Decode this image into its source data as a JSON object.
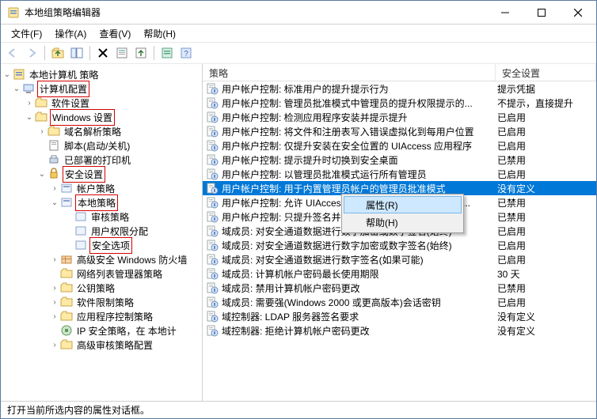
{
  "window": {
    "title": "本地组策略编辑器"
  },
  "menubar": [
    {
      "id": "file",
      "label": "文件(F)"
    },
    {
      "id": "action",
      "label": "操作(A)"
    },
    {
      "id": "view",
      "label": "查看(V)"
    },
    {
      "id": "help",
      "label": "帮助(H)"
    }
  ],
  "tree": {
    "root": "本地计算机 策略",
    "computer_config": "计算机配置",
    "software_settings": "软件设置",
    "windows_settings": "Windows 设置",
    "dns_policy": "域名解析策略",
    "scripts": "脚本(启动/关机)",
    "deployed_printers": "已部署的打印机",
    "security_settings": "安全设置",
    "account_policies": "帐户策略",
    "local_policies": "本地策略",
    "audit_policy": "审核策略",
    "user_rights": "用户权限分配",
    "security_options": "安全选项",
    "advanced_fw": "高级安全 Windows 防火墙",
    "network_list": "网络列表管理器策略",
    "public_key": "公钥策略",
    "software_restrict": "软件限制策略",
    "app_control": "应用程序控制策略",
    "ip_sec": "IP 安全策略，在 本地计",
    "advanced_audit": "高级审核策略配置"
  },
  "columns": {
    "policy": "策略",
    "setting": "安全设置"
  },
  "policies": [
    {
      "name": "用户帐户控制: 标准用户的提升提示行为",
      "value": "提示凭据"
    },
    {
      "name": "用户帐户控制: 管理员批准模式中管理员的提升权限提示的...",
      "value": "不提示，直接提升"
    },
    {
      "name": "用户帐户控制: 检测应用程序安装并提示提升",
      "value": "已启用"
    },
    {
      "name": "用户帐户控制: 将文件和注册表写入错误虚拟化到每用户位置",
      "value": "已启用"
    },
    {
      "name": "用户帐户控制: 仅提升安装在安全位置的 UIAccess 应用程序",
      "value": "已启用"
    },
    {
      "name": "用户帐户控制: 提示提升时切换到安全桌面",
      "value": "已禁用"
    },
    {
      "name": "用户帐户控制: 以管理员批准模式运行所有管理员",
      "value": "已启用"
    },
    {
      "name": "用户帐户控制: 用于内置管理员帐户的管理员批准模式",
      "value": "没有定义",
      "selected": true
    },
    {
      "name": "用户帐户控制: 允许 UIAccess 应用程序在不使用安全桌面...",
      "value": "已禁用"
    },
    {
      "name": "用户帐户控制: 只提升签名并验证的可执行文件",
      "value": "已禁用"
    },
    {
      "name": "域成员: 对安全通道数据进行数字加密或数字签名(始终)",
      "value": "已启用"
    },
    {
      "name": "域成员: 对安全通道数据进行数字加密或数字签名(始终)",
      "value": "已启用"
    },
    {
      "name": "域成员: 对安全通道数据进行数字签名(如果可能)",
      "value": "已启用"
    },
    {
      "name": "域成员: 计算机帐户密码最长使用期限",
      "value": "30 天"
    },
    {
      "name": "域成员: 禁用计算机帐户密码更改",
      "value": "已禁用"
    },
    {
      "name": "域成员: 需要强(Windows 2000 或更高版本)会话密钥",
      "value": "已启用"
    },
    {
      "name": "域控制器: LDAP 服务器签名要求",
      "value": "没有定义"
    },
    {
      "name": "域控制器: 拒绝计算机帐户密码更改",
      "value": "没有定义"
    }
  ],
  "context_menu": {
    "properties": "属性(R)",
    "help": "帮助(H)"
  },
  "statusbar": "打开当前所选内容的属性对话框。"
}
